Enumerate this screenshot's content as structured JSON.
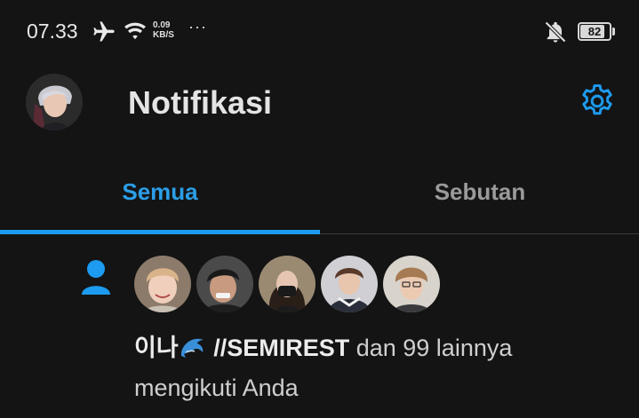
{
  "status_bar": {
    "time": "07.33",
    "net_speed_value": "0.09",
    "net_speed_unit": "KB/S",
    "more": "···",
    "battery": "82",
    "battery_level": 0.82,
    "icons": [
      "airplane-icon",
      "wifi-icon",
      "mute-icon",
      "battery-icon"
    ]
  },
  "header": {
    "title": "Notifikasi",
    "icons": [
      "avatar",
      "gear-icon"
    ]
  },
  "tabs": [
    {
      "label": "Semua",
      "active": true
    },
    {
      "label": "Sebutan",
      "active": false
    }
  ],
  "notification": {
    "icon": "person-icon",
    "avatar_count": 5,
    "user_name_prefix": "이나",
    "user_name_emoji": "dolphin-icon",
    "user_name_suffix": " //SEMIREST",
    "text_rest": " dan 99 lainnya mengikuti Anda"
  },
  "colors": {
    "accent": "#1d9bf0",
    "background": "#141414",
    "text": "#e4e4e4",
    "muted_text": "#9a9a9a"
  }
}
